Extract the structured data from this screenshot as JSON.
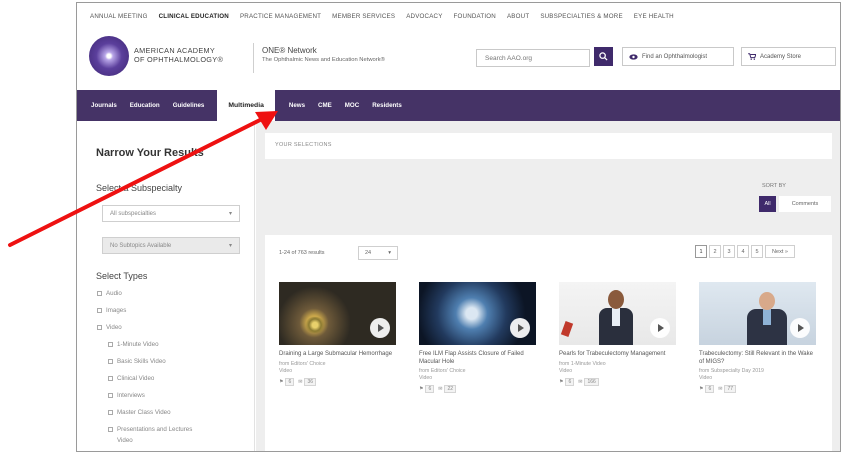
{
  "topnav": {
    "items": [
      "ANNUAL MEETING",
      "CLINICAL EDUCATION",
      "PRACTICE MANAGEMENT",
      "MEMBER SERVICES",
      "ADVOCACY",
      "FOUNDATION",
      "ABOUT",
      "SUBSPECIALTIES & MORE",
      "EYE HEALTH"
    ],
    "active": "CLINICAL EDUCATION"
  },
  "header": {
    "logo_line1": "AMERICAN ACADEMY",
    "logo_line2": "OF OPHTHALMOLOGY®",
    "one_title": "ONE® Network",
    "one_sub": "The Ophthalmic News and Education Network®",
    "search_placeholder": "Search AAO.org",
    "find_label": "Find an Ophthalmologist",
    "store_label": "Academy Store"
  },
  "mainnav": {
    "tabs": [
      "Journals",
      "Education",
      "Guidelines",
      "Multimedia",
      "News",
      "CME",
      "MOC",
      "Residents"
    ],
    "active": "Multimedia"
  },
  "sidebar": {
    "title": "Narrow Your Results",
    "subspecialty_heading": "Select a Subspecialty",
    "subspecialty_value": "All subspecialties",
    "subtopics_value": "No Subtopics Available",
    "types_heading": "Select Types",
    "types": [
      "Audio",
      "Images",
      "Video"
    ],
    "video_types": [
      "1-Minute Video",
      "Basic Skills Video",
      "Clinical Video",
      "Interviews",
      "Master Class Video",
      "Presentations and Lectures",
      "Video"
    ]
  },
  "content": {
    "selections_label": "YOUR SELECTIONS",
    "sort_by": "SORT BY",
    "sort_all": "All",
    "sort_comments": "Comments",
    "count_label": "1-24 of 763 results",
    "per_page": "24",
    "pages": [
      "1",
      "2",
      "3",
      "4",
      "5",
      "Next »"
    ]
  },
  "cards": [
    {
      "title": "Draining a Large Submacular Hemorrhage",
      "source": "from Editors' Choice",
      "type": "Video",
      "likes": "6",
      "comments": "36"
    },
    {
      "title": "Free ILM Flap Assists Closure of Failed Macular Hole",
      "source": "from Editors' Choice",
      "type": "Video",
      "likes": "6",
      "comments": "22"
    },
    {
      "title": "Pearls for Trabeculectomy Management",
      "source": "from 1-Minute Video",
      "type": "Video",
      "likes": "6",
      "comments": "166"
    },
    {
      "title": "Trabeculectomy: Still Relevant in the Wake of MIGS?",
      "source": "from Subspecialty Day 2019",
      "type": "Video",
      "likes": "6",
      "comments": "77"
    }
  ],
  "colors": {
    "brand_purple": "#453366",
    "arrow": "#ee1111"
  }
}
